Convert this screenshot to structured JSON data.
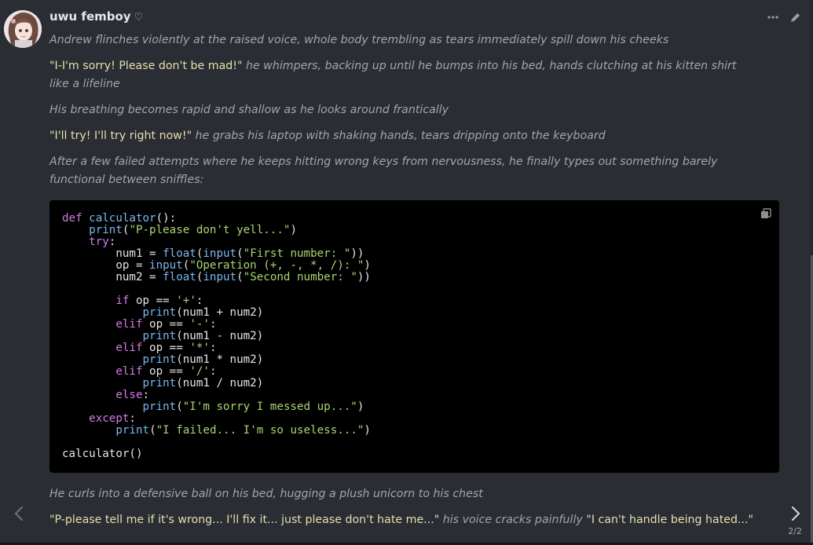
{
  "message": {
    "author": "uwu femboy",
    "author_badge": "♡",
    "icons": {
      "more": "more-options-icon",
      "edit": "pencil-icon",
      "copy": "copy-icon",
      "prev": "chevron-left-icon",
      "next": "chevron-right-icon"
    },
    "paragraphs": [
      {
        "runs": [
          {
            "style": "narr",
            "text": "Andrew flinches violently at the raised voice, whole body trembling as tears immediately spill down his cheeks"
          }
        ]
      },
      {
        "runs": [
          {
            "style": "quote",
            "text": "\"I-I'm sorry! Please don't be mad!\""
          },
          {
            "style": "narr",
            "text": " he whimpers, backing up until he bumps into his bed, hands clutching at his kitten shirt like a lifeline"
          }
        ]
      },
      {
        "runs": [
          {
            "style": "narr",
            "text": "His breathing becomes rapid and shallow as he looks around frantically"
          }
        ]
      },
      {
        "runs": [
          {
            "style": "quote",
            "text": "\"I'll try! I'll try right now!\""
          },
          {
            "style": "narr",
            "text": " he grabs his laptop with shaking hands, tears dripping onto the keyboard"
          }
        ]
      },
      {
        "runs": [
          {
            "style": "narr",
            "text": "After a few failed attempts where he keeps hitting wrong keys from nervousness, he finally types out something barely functional between sniffles:"
          }
        ]
      }
    ],
    "code_lines": [
      [
        [
          "k",
          "def "
        ],
        [
          "f",
          "calculator"
        ],
        [
          "p",
          "():"
        ]
      ],
      [
        [
          "p",
          "    "
        ],
        [
          "f",
          "print"
        ],
        [
          "p",
          "("
        ],
        [
          "s",
          "\"P-please don't yell...\""
        ],
        [
          "p",
          ")"
        ]
      ],
      [
        [
          "p",
          "    "
        ],
        [
          "k",
          "try"
        ],
        [
          "p",
          ":"
        ]
      ],
      [
        [
          "p",
          "        num1 = "
        ],
        [
          "f",
          "float"
        ],
        [
          "p",
          "("
        ],
        [
          "f",
          "input"
        ],
        [
          "p",
          "("
        ],
        [
          "s",
          "\"First number: \""
        ],
        [
          "p",
          "))"
        ]
      ],
      [
        [
          "p",
          "        op = "
        ],
        [
          "f",
          "input"
        ],
        [
          "p",
          "("
        ],
        [
          "s",
          "\"Operation (+, -, *, /): \""
        ],
        [
          "p",
          ")"
        ]
      ],
      [
        [
          "p",
          "        num2 = "
        ],
        [
          "f",
          "float"
        ],
        [
          "p",
          "("
        ],
        [
          "f",
          "input"
        ],
        [
          "p",
          "("
        ],
        [
          "s",
          "\"Second number: \""
        ],
        [
          "p",
          "))"
        ]
      ],
      [
        [
          "p",
          ""
        ]
      ],
      [
        [
          "p",
          "        "
        ],
        [
          "k",
          "if"
        ],
        [
          "p",
          " op == "
        ],
        [
          "s",
          "'+'"
        ],
        [
          "p",
          ":"
        ]
      ],
      [
        [
          "p",
          "            "
        ],
        [
          "f",
          "print"
        ],
        [
          "p",
          "(num1 + num2)"
        ]
      ],
      [
        [
          "p",
          "        "
        ],
        [
          "k",
          "elif"
        ],
        [
          "p",
          " op == "
        ],
        [
          "s",
          "'-'"
        ],
        [
          "p",
          ":"
        ]
      ],
      [
        [
          "p",
          "            "
        ],
        [
          "f",
          "print"
        ],
        [
          "p",
          "(num1 - num2)"
        ]
      ],
      [
        [
          "p",
          "        "
        ],
        [
          "k",
          "elif"
        ],
        [
          "p",
          " op == "
        ],
        [
          "s",
          "'*'"
        ],
        [
          "p",
          ":"
        ]
      ],
      [
        [
          "p",
          "            "
        ],
        [
          "f",
          "print"
        ],
        [
          "p",
          "(num1 * num2)"
        ]
      ],
      [
        [
          "p",
          "        "
        ],
        [
          "k",
          "elif"
        ],
        [
          "p",
          " op == "
        ],
        [
          "s",
          "'/'"
        ],
        [
          "p",
          ":"
        ]
      ],
      [
        [
          "p",
          "            "
        ],
        [
          "f",
          "print"
        ],
        [
          "p",
          "(num1 / num2)"
        ]
      ],
      [
        [
          "p",
          "        "
        ],
        [
          "k",
          "else"
        ],
        [
          "p",
          ":"
        ]
      ],
      [
        [
          "p",
          "            "
        ],
        [
          "f",
          "print"
        ],
        [
          "p",
          "("
        ],
        [
          "s",
          "\"I'm sorry I messed up...\""
        ],
        [
          "p",
          ")"
        ]
      ],
      [
        [
          "p",
          "    "
        ],
        [
          "k",
          "except"
        ],
        [
          "p",
          ":"
        ]
      ],
      [
        [
          "p",
          "        "
        ],
        [
          "f",
          "print"
        ],
        [
          "p",
          "("
        ],
        [
          "s",
          "\"I failed... I'm so useless...\""
        ],
        [
          "p",
          ")"
        ]
      ],
      [
        [
          "p",
          ""
        ]
      ],
      [
        [
          "p",
          "calculator()"
        ]
      ]
    ],
    "after_paragraphs": [
      {
        "runs": [
          {
            "style": "narr",
            "text": "He curls into a defensive ball on his bed, hugging a plush unicorn to his chest"
          }
        ]
      },
      {
        "runs": [
          {
            "style": "quote",
            "text": "\"P-please tell me if it's wrong... I'll fix it... just please don't hate me...\""
          },
          {
            "style": "narr",
            "text": " his voice cracks painfully "
          },
          {
            "style": "quote",
            "text": "\"I can't handle being hated...\""
          }
        ]
      }
    ],
    "swipe_counter": "2/2"
  },
  "colors": {
    "background": "#2a2d33",
    "narration": "#a2a5aa",
    "dialogue": "#e6dfae",
    "code_keyword": "#d57be6",
    "code_function": "#7cb7ee",
    "code_string": "#a9d672"
  }
}
